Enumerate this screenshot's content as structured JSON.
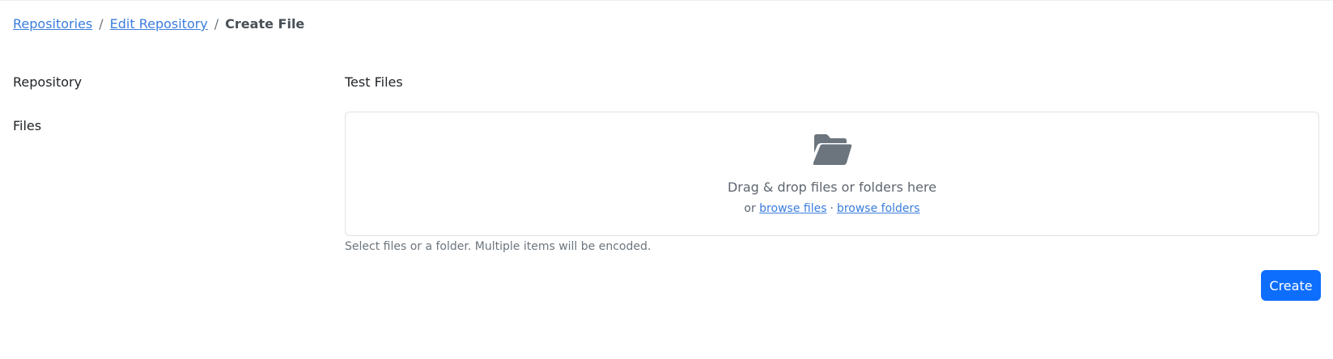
{
  "breadcrumb": {
    "items": [
      {
        "label": "Repositories"
      },
      {
        "label": "Edit Repository"
      }
    ],
    "separator": "/",
    "current": "Create File"
  },
  "form": {
    "repository_label": "Repository",
    "repository_value": "Test Files",
    "files_label": "Files",
    "dropzone": {
      "icon": "folder-open-icon",
      "title": "Drag & drop files or folders here",
      "or_text": "or",
      "browse_files": "browse files",
      "divider": "·",
      "browse_folders": "browse folders"
    },
    "help_text": "Select files or a folder. Multiple items will be encoded.",
    "create_label": "Create"
  },
  "colors": {
    "link": "#3b7ddd",
    "primary": "#0d6efd",
    "icon": "#6c757d"
  }
}
